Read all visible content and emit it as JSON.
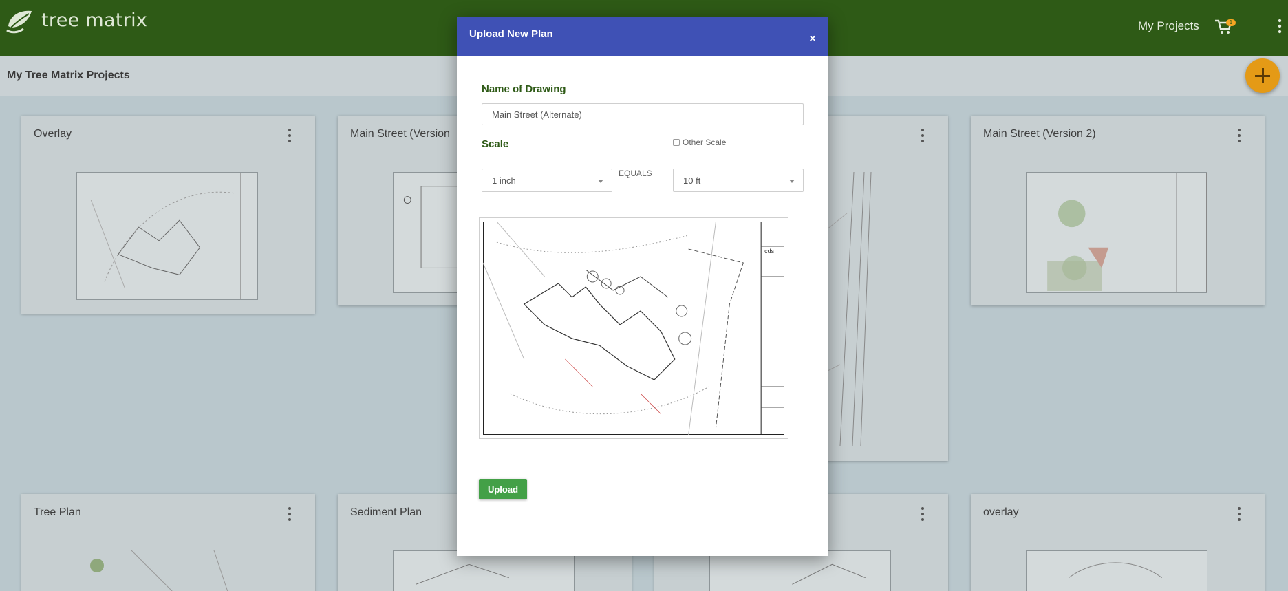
{
  "app": {
    "brand": "tree matrix",
    "nav_projects": "My Projects",
    "cart_count": "1",
    "page_title": "My Tree Matrix Projects"
  },
  "cards": [
    {
      "title": "Overlay"
    },
    {
      "title": "Main Street (Version "
    },
    {
      "title": ""
    },
    {
      "title": "Main Street (Version 2)"
    },
    {
      "title": "Tree Plan"
    },
    {
      "title": "Sediment Plan"
    },
    {
      "title": ""
    },
    {
      "title": "overlay"
    }
  ],
  "modal": {
    "title": "Upload New Plan",
    "close": "×",
    "name_label": "Name of Drawing",
    "name_value": "Main Street (Alternate)",
    "scale_label": "Scale",
    "other_scale_label": "Other Scale",
    "scale_from": "1 inch",
    "equals": "EQUALS",
    "scale_to": "10 ft",
    "upload_label": "Upload"
  },
  "icons": {
    "logo": "leaf-logo-icon",
    "cart": "cart-icon",
    "menu": "kebab-menu-icon",
    "add": "plus-icon"
  },
  "colors": {
    "topbar": "#2e5a16",
    "modal_header": "#3f51b5",
    "accent_green": "#43a047",
    "fab": "#e49a16"
  }
}
